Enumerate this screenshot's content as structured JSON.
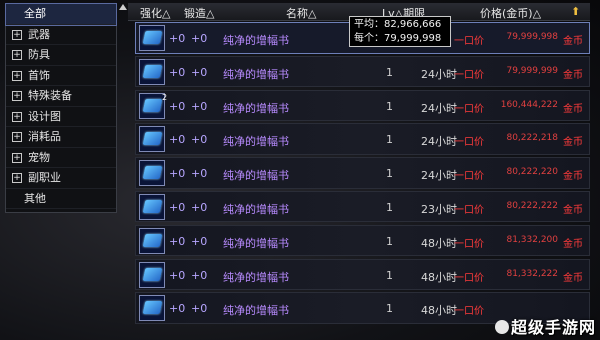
{
  "sidebar": {
    "items": [
      {
        "label": "全部",
        "plus": false,
        "selected": true
      },
      {
        "label": "武器",
        "plus": true
      },
      {
        "label": "防具",
        "plus": true
      },
      {
        "label": "首饰",
        "plus": true
      },
      {
        "label": "特殊装备",
        "plus": true
      },
      {
        "label": "设计图",
        "plus": true
      },
      {
        "label": "消耗品",
        "plus": true
      },
      {
        "label": "宠物",
        "plus": true
      },
      {
        "label": "副职业",
        "plus": true
      },
      {
        "label": "其他",
        "plus": false
      }
    ]
  },
  "header": {
    "enhance": "强化△",
    "forge": "锻造△",
    "name": "名称△",
    "level_term": "Lv△期限",
    "price": "价格(金币)△",
    "pin_icon": "pin-icon"
  },
  "tooltip": {
    "avg_label": "平均：",
    "avg_value": "82,966,666",
    "each_label": "每个：",
    "each_value": "79,999,998"
  },
  "rows": [
    {
      "stack": "",
      "enhance": "+0",
      "forge": "+0",
      "name": "纯净的增幅书",
      "lv": "",
      "term": "",
      "mode": "一口价",
      "price": "79,999,998",
      "unit": "金币"
    },
    {
      "stack": "",
      "enhance": "+0",
      "forge": "+0",
      "name": "纯净的增幅书",
      "lv": "1",
      "term": "24小时",
      "mode": "一口价",
      "price": "79,999,999",
      "unit": "金币"
    },
    {
      "stack": "2",
      "enhance": "+0",
      "forge": "+0",
      "name": "纯净的增幅书",
      "lv": "1",
      "term": "24小时",
      "mode": "一口价",
      "price": "160,444,222",
      "unit": "金币"
    },
    {
      "stack": "",
      "enhance": "+0",
      "forge": "+0",
      "name": "纯净的增幅书",
      "lv": "1",
      "term": "24小时",
      "mode": "一口价",
      "price": "80,222,218",
      "unit": "金币"
    },
    {
      "stack": "",
      "enhance": "+0",
      "forge": "+0",
      "name": "纯净的增幅书",
      "lv": "1",
      "term": "24小时",
      "mode": "一口价",
      "price": "80,222,220",
      "unit": "金币"
    },
    {
      "stack": "",
      "enhance": "+0",
      "forge": "+0",
      "name": "纯净的增幅书",
      "lv": "1",
      "term": "23小时",
      "mode": "一口价",
      "price": "80,222,222",
      "unit": "金币"
    },
    {
      "stack": "",
      "enhance": "+0",
      "forge": "+0",
      "name": "纯净的增幅书",
      "lv": "1",
      "term": "48小时",
      "mode": "一口价",
      "price": "81,332,200",
      "unit": "金币"
    },
    {
      "stack": "",
      "enhance": "+0",
      "forge": "+0",
      "name": "纯净的增幅书",
      "lv": "1",
      "term": "48小时",
      "mode": "一口价",
      "price": "81,332,222",
      "unit": "金币"
    },
    {
      "stack": "",
      "enhance": "+0",
      "forge": "+0",
      "name": "纯净的增幅书",
      "lv": "1",
      "term": "48小时",
      "mode": "一口价",
      "price": "",
      "unit": ""
    }
  ],
  "watermark": "超级手游网",
  "colors": {
    "price_red": "#e04040",
    "name_purple": "#b88bff",
    "selected_blue": "#1d2640"
  }
}
